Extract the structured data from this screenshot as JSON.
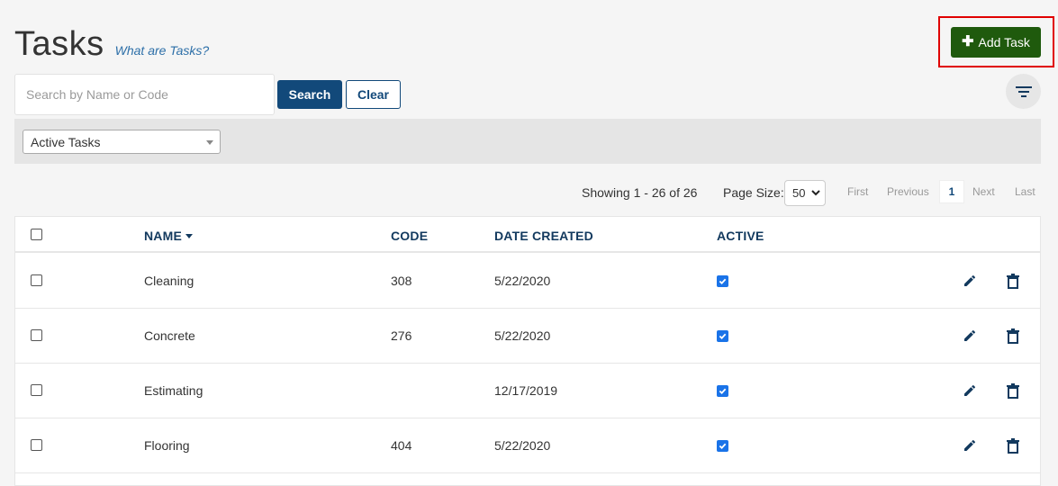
{
  "header": {
    "title": "Tasks",
    "help_link": "What are Tasks?",
    "add_button": "Add Task",
    "add_icon": "plus-icon"
  },
  "search": {
    "placeholder": "Search by Name or Code",
    "value": "",
    "search_label": "Search",
    "clear_label": "Clear",
    "filter_icon": "filter-icon"
  },
  "filter": {
    "selected": "Active Tasks"
  },
  "pagination": {
    "showing": "Showing 1 - 26 of 26",
    "page_size_label": "Page Size:",
    "page_size": "50",
    "first": "First",
    "previous": "Previous",
    "current": "1",
    "next": "Next",
    "last": "Last"
  },
  "table": {
    "columns": [
      "NAME",
      "CODE",
      "DATE CREATED",
      "ACTIVE"
    ],
    "sorted_column": "NAME",
    "rows": [
      {
        "name": "Cleaning",
        "code": "308",
        "date": "5/22/2020",
        "active": true
      },
      {
        "name": "Concrete",
        "code": "276",
        "date": "5/22/2020",
        "active": true
      },
      {
        "name": "Estimating",
        "code": "",
        "date": "12/17/2019",
        "active": true
      },
      {
        "name": "Flooring",
        "code": "404",
        "date": "5/22/2020",
        "active": true
      }
    ],
    "row_actions": [
      "pencil-icon",
      "trash-icon"
    ]
  },
  "colors": {
    "primary": "#12497a",
    "add_button": "#1f5a0d",
    "highlight": "#e00000",
    "header_text": "#12395e",
    "checkbox": "#1a73e8"
  }
}
